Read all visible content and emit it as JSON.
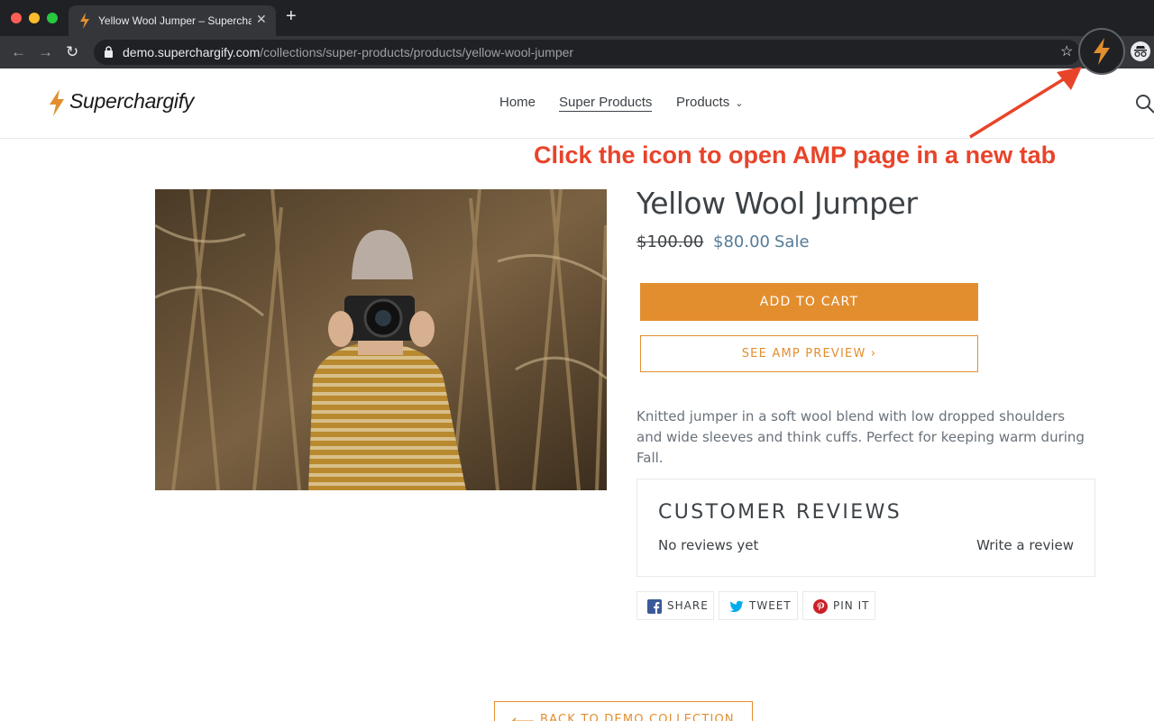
{
  "browser": {
    "tab_title": "Yellow Wool Jumper – Superchargify",
    "tab_close": "✕",
    "new_tab": "+",
    "nav_back": "←",
    "nav_forward": "→",
    "reload": "↻",
    "url_domain": "demo.superchargify.com",
    "url_path": "/collections/super-products/products/yellow-wool-jumper",
    "bookmark": "☆",
    "extension_icon": "bolt-icon",
    "profile_icon": "incognito-icon"
  },
  "site": {
    "logo": "Superchargify",
    "nav": [
      {
        "label": "Home"
      },
      {
        "label": "Super Products"
      },
      {
        "label": "Products"
      }
    ],
    "nav_dropdown": "⌄"
  },
  "annotation": {
    "text": "Click the icon to open AMP page in a new tab",
    "color": "#e8442a"
  },
  "product": {
    "title": "Yellow Wool Jumper",
    "compare_price": "$100.00",
    "sale_price": "$80.00",
    "sale_label": "Sale",
    "add_to_cart": "ADD TO CART",
    "amp_preview": "SEE AMP PREVIEW ›",
    "description": "Knitted jumper in a soft wool blend with low dropped shoulders and wide sleeves and think cuffs. Perfect for keeping warm during Fall.",
    "accent_color": "#e28e2f",
    "price_color": "#557b97"
  },
  "reviews": {
    "title": "CUSTOMER REVIEWS",
    "empty": "No reviews yet",
    "write": "Write a review"
  },
  "share": [
    {
      "label": "SHARE",
      "icon": "facebook-icon"
    },
    {
      "label": "TWEET",
      "icon": "twitter-icon"
    },
    {
      "label": "PIN IT",
      "icon": "pinterest-icon"
    }
  ],
  "back": {
    "arrow": "⟵",
    "label": "BACK TO DEMO COLLECTION"
  }
}
